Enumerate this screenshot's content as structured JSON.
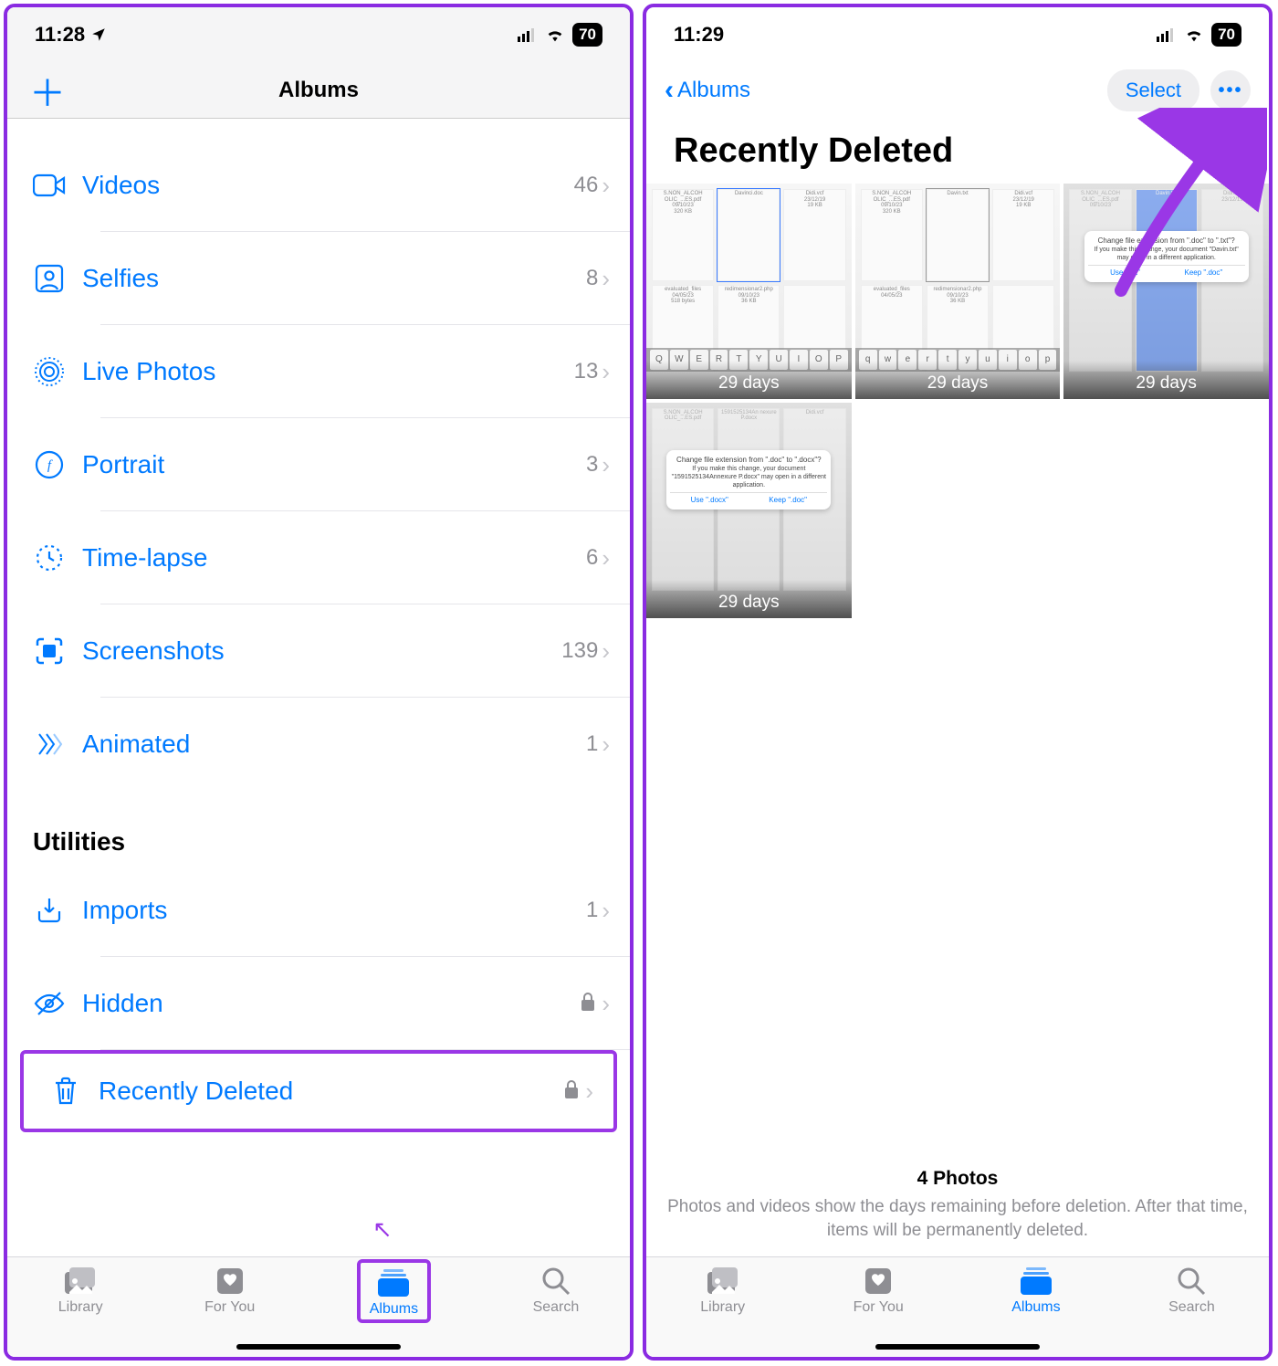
{
  "left": {
    "status": {
      "time": "11:28",
      "battery": "70"
    },
    "nav": {
      "title": "Albums",
      "plus": "＋"
    },
    "mediaTypes": [
      {
        "icon": "videocam",
        "label": "Videos",
        "count": "46"
      },
      {
        "icon": "selfie",
        "label": "Selfies",
        "count": "8"
      },
      {
        "icon": "livephoto",
        "label": "Live Photos",
        "count": "13"
      },
      {
        "icon": "portrait",
        "label": "Portrait",
        "count": "3"
      },
      {
        "icon": "timelapse",
        "label": "Time-lapse",
        "count": "6"
      },
      {
        "icon": "screenshot",
        "label": "Screenshots",
        "count": "139"
      },
      {
        "icon": "animated",
        "label": "Animated",
        "count": "1"
      }
    ],
    "utilitiesTitle": "Utilities",
    "utilities": [
      {
        "icon": "import",
        "label": "Imports",
        "count": "1",
        "lock": false
      },
      {
        "icon": "hidden",
        "label": "Hidden",
        "count": "",
        "lock": true
      },
      {
        "icon": "trash",
        "label": "Recently Deleted",
        "count": "",
        "lock": true,
        "highlight": true
      }
    ],
    "tabs": [
      {
        "label": "Library"
      },
      {
        "label": "For You"
      },
      {
        "label": "Albums"
      },
      {
        "label": "Search"
      }
    ]
  },
  "right": {
    "status": {
      "time": "11:29",
      "battery": "70"
    },
    "back": "Albums",
    "select": "Select",
    "title": "Recently Deleted",
    "thumbs": [
      {
        "caption": "29 days"
      },
      {
        "caption": "29 days"
      },
      {
        "caption": "29 days"
      },
      {
        "caption": "29 days"
      }
    ],
    "footerCount": "4 Photos",
    "footerDesc": "Photos and videos show the days remaining before deletion. After that time, items will be permanently deleted.",
    "tabs": [
      {
        "label": "Library"
      },
      {
        "label": "For You"
      },
      {
        "label": "Albums"
      },
      {
        "label": "Search"
      }
    ]
  }
}
